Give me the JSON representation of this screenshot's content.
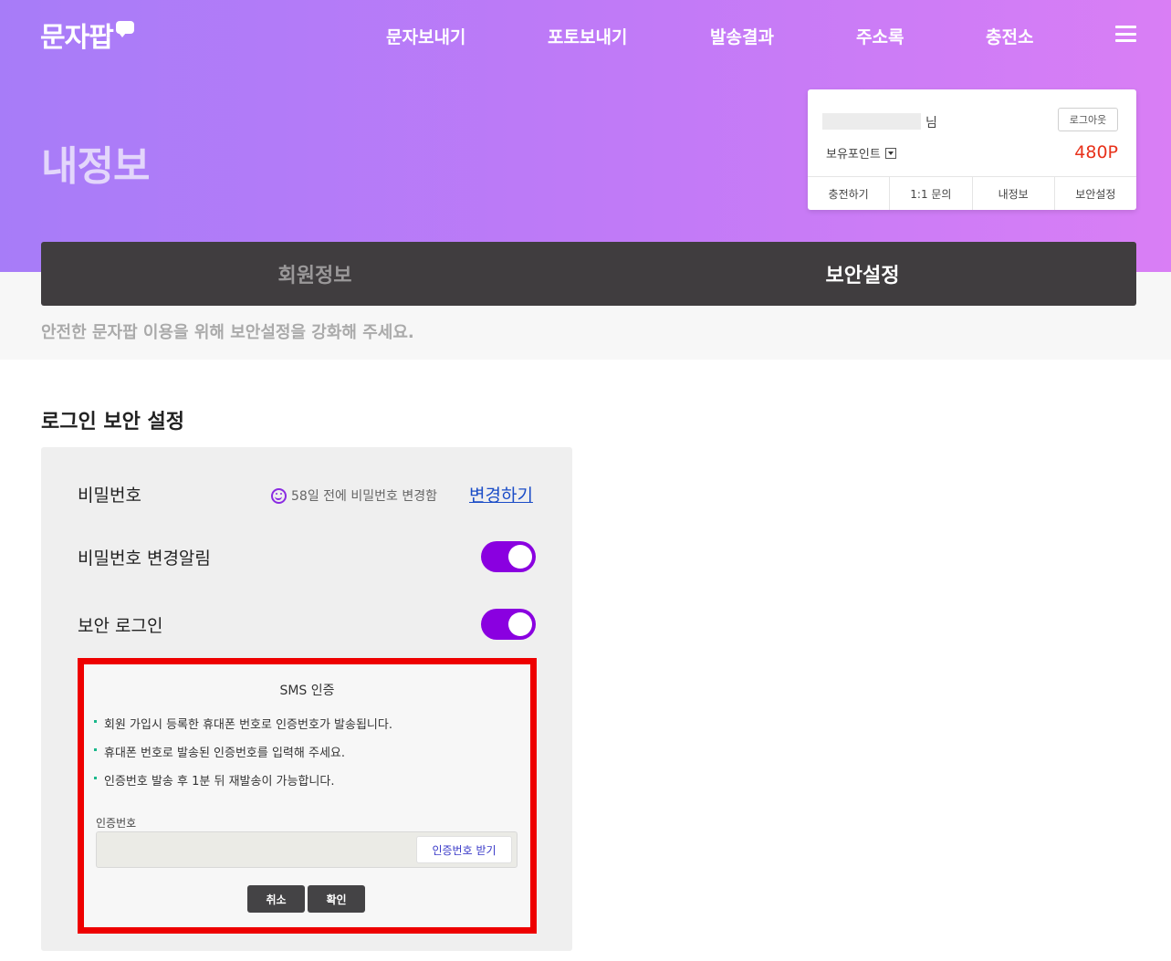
{
  "brand": {
    "logo": "문자팝",
    "logo_icon": "speech-bubble-icon"
  },
  "nav": {
    "items": [
      {
        "label": "문자보내기"
      },
      {
        "label": "포토보내기"
      },
      {
        "label": "발송결과"
      },
      {
        "label": "주소록"
      },
      {
        "label": "충전소"
      }
    ],
    "menu_icon": "hamburger-menu-icon"
  },
  "page": {
    "title": "내정보"
  },
  "user_card": {
    "name_suffix": "님",
    "logout_label": "로그아웃",
    "points_label": "보유포인트",
    "points_value": "480P",
    "links": [
      {
        "label": "충전하기"
      },
      {
        "label": "1:1 문의"
      },
      {
        "label": "내정보"
      },
      {
        "label": "보안설정"
      }
    ]
  },
  "tabs": [
    {
      "label": "회원정보",
      "active": false
    },
    {
      "label": "보안설정",
      "active": true
    }
  ],
  "notice": "안전한 문자팝 이용을 위해 보안설정을 강화해 주세요.",
  "security": {
    "section_title": "로그인 보안 설정",
    "password": {
      "label": "비밀번호",
      "status": "58일 전에 비밀번호 변경함",
      "change_label": "변경하기"
    },
    "password_alert": {
      "label": "비밀번호 변경알림",
      "enabled": true
    },
    "secure_login": {
      "label": "보안 로그인",
      "enabled": true
    },
    "sms": {
      "title": "SMS 인증",
      "bullets": [
        "회원 가입시 등록한 휴대폰 번호로 인증번호가 발송됩니다.",
        "휴대폰 번호로 발송된 인증번호를 입력해 주세요.",
        "인증번호 발송 후 1분 뒤 재발송이 가능합니다."
      ],
      "code_label": "인증번호",
      "code_value": "",
      "get_code_label": "인증번호 받기",
      "cancel_label": "취소",
      "confirm_label": "확인"
    }
  },
  "colors": {
    "accent": "#8a00e0",
    "points": "#e8321b",
    "highlight_border": "#ee0000",
    "tab_bar": "#403d3f"
  }
}
